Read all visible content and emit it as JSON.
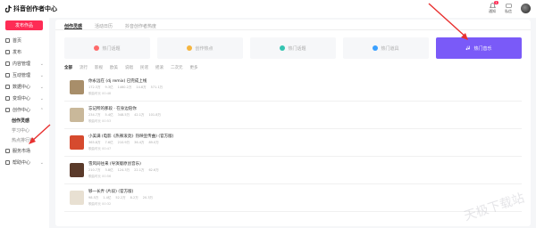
{
  "app": {
    "title": "抖音创作者中心"
  },
  "topbar": {
    "items": [
      {
        "label": "通知",
        "badge": "1"
      },
      {
        "label": "私信",
        "badge": ""
      }
    ]
  },
  "sidebar": {
    "publish_label": "发布作品",
    "items": [
      {
        "label": "首页"
      },
      {
        "label": "发布"
      },
      {
        "label": "内容管理",
        "chevron": "⌄"
      },
      {
        "label": "互动管理",
        "chevron": "⌄"
      },
      {
        "label": "数据中心",
        "chevron": "⌄"
      },
      {
        "label": "变现中心",
        "chevron": "⌄"
      },
      {
        "label": "创作中心",
        "chevron": "⌃"
      }
    ],
    "subitems": [
      {
        "label": "创作灵感",
        "active": true
      },
      {
        "label": "学习中心",
        "active": false
      },
      {
        "label": "热点排行榜",
        "active": false
      }
    ],
    "more_items": [
      {
        "label": "服务市场"
      },
      {
        "label": "帮助中心",
        "chevron": "⌄"
      }
    ]
  },
  "main": {
    "tabs": [
      {
        "label": "创作灵感",
        "active": true
      },
      {
        "label": "活动日历",
        "active": false
      },
      {
        "label": "抖音创作者热度",
        "active": false
      }
    ],
    "cards": [
      {
        "label": "热门话题",
        "color": "#fe6b6b"
      },
      {
        "label": "创作热点",
        "color": "#f5b540"
      },
      {
        "label": "热门话题",
        "color": "#35c4b1"
      },
      {
        "label": "热门道具",
        "color": "#3aa0ff"
      },
      {
        "label": "热门音乐",
        "color": "#ffffff",
        "active": true
      }
    ],
    "filters": [
      "全部",
      "流行",
      "影视",
      "欧美",
      "说唱",
      "民谣",
      "摇滚",
      "二次元",
      "更多"
    ],
    "rows": [
      {
        "title": "你永远在 (dj remix) 已完成上线",
        "stats": [
          "172.3万",
          "9.3亿",
          "1460.2万",
          "14.8万",
          "571.1万"
        ],
        "date": "歌曲时长 00:48",
        "thumb": "#a88e6a"
      },
      {
        "title": "忘记所的那段 · 在身边陪你",
        "stats": [
          "234.7万",
          "5.4亿",
          "348.5万",
          "42.1万",
          "101.8万"
        ],
        "date": "歌曲时长 00:53",
        "thumb": "#c9b89a"
      },
      {
        "title": "小美满 (电影《热辣滚烫》热映宣传曲) (官方版)",
        "stats": [
          "365.8万",
          "7.6亿",
          "210.9万",
          "36.4万",
          "89.0万"
        ],
        "date": "歌曲时长 00:47",
        "thumb": "#d64a2e"
      },
      {
        "title": "雪风同往来 (导演版原创音乐)",
        "stats": [
          "210.7万",
          "3.8亿",
          "124.3万",
          "22.1万",
          "62.6万"
        ],
        "date": "歌曲时长 00:56",
        "thumb": "#5a3a2a"
      },
      {
        "title": "够一长弄 (片段) (官方版)",
        "stats": [
          "98.5万",
          "1.4亿",
          "52.2万",
          "8.2万",
          "20.3万"
        ],
        "date": "歌曲时长 00:32",
        "thumb": "#e8e0d2"
      }
    ]
  },
  "watermark": "天极下载站"
}
